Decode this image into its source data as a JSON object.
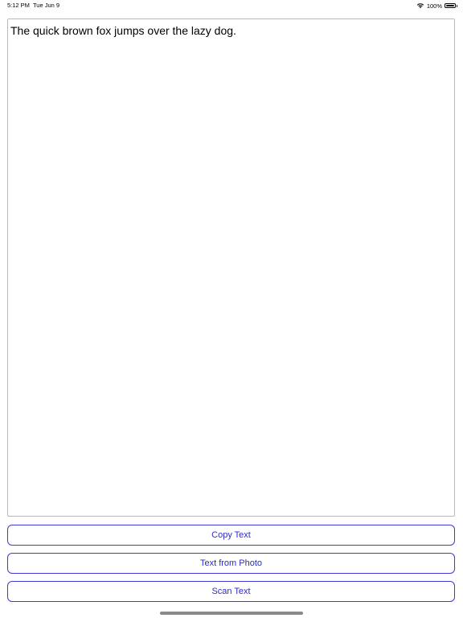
{
  "status_bar": {
    "time": "5:12 PM",
    "date": "Tue Jun 9",
    "battery_percent": "100%",
    "icons": [
      "wifi-icon",
      "battery-icon"
    ]
  },
  "editor": {
    "text": "The quick brown fox jumps over the lazy dog."
  },
  "buttons": {
    "copy_label": "Copy Text",
    "photo_label": "Text from Photo",
    "scan_label": "Scan Text"
  },
  "colors": {
    "accent": "#2b2bc6",
    "button_border": "#3b3bd6",
    "text_area_border": "#b8b8b8"
  }
}
